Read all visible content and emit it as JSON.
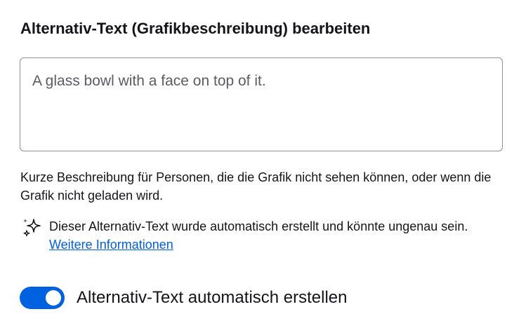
{
  "dialog": {
    "title": "Alternativ-Text (Grafikbeschreibung) bearbeiten",
    "alt_text_value": "A glass bowl with a face on top of it.",
    "help_text": "Kurze Beschreibung für Personen, die die Grafik nicht sehen können, oder wenn die Grafik nicht geladen wird.",
    "notice": {
      "icon": "sparkle-icon",
      "text": "Dieser Alternativ-Text wurde automatisch erstellt und könnte ungenau sein.",
      "link_label": "Weitere Informationen"
    },
    "toggle": {
      "label": "Alternativ-Text automatisch erstellen",
      "checked": true
    }
  },
  "colors": {
    "accent": "#0061e0",
    "link": "#0061e0",
    "border": "#8f8f9d",
    "text": "#15141a",
    "muted_text": "#5b5b66"
  }
}
